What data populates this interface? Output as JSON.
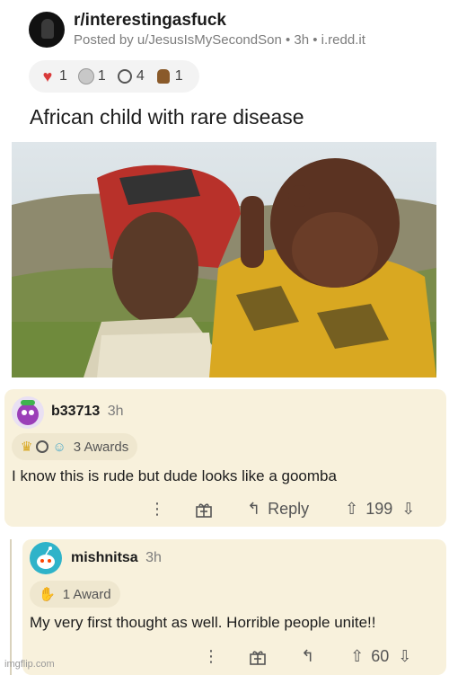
{
  "post": {
    "subreddit": "r/interestingasfuck",
    "posted_by": "Posted by u/JesusIsMySecondSon",
    "time": "3h",
    "domain": "i.redd.it",
    "title": "African child with rare disease",
    "awards": [
      {
        "icon": "heart-award-icon",
        "count": "1"
      },
      {
        "icon": "silver-award-icon",
        "count": "1"
      },
      {
        "icon": "wave-award-icon",
        "count": "4"
      },
      {
        "icon": "bag-award-icon",
        "count": "1"
      }
    ]
  },
  "comments": [
    {
      "user": "b33713",
      "time": "3h",
      "awards_label": "3 Awards",
      "text": "I know this is rude but dude looks like a goomba",
      "reply_label": "Reply",
      "score": "199"
    },
    {
      "user": "mishnitsa",
      "time": "3h",
      "awards_label": "1 Award",
      "text": "My very first thought as well.  Horrible people unite!!",
      "score": "60"
    }
  ],
  "watermark": "imgflip.com",
  "colors": {
    "comment_bg": "#f8f1dc",
    "meta_gray": "#7c7c7c",
    "award_red": "#d93a3a",
    "avatar_teal": "#2fb3c9",
    "avatar_purple": "#9b3fb8"
  }
}
